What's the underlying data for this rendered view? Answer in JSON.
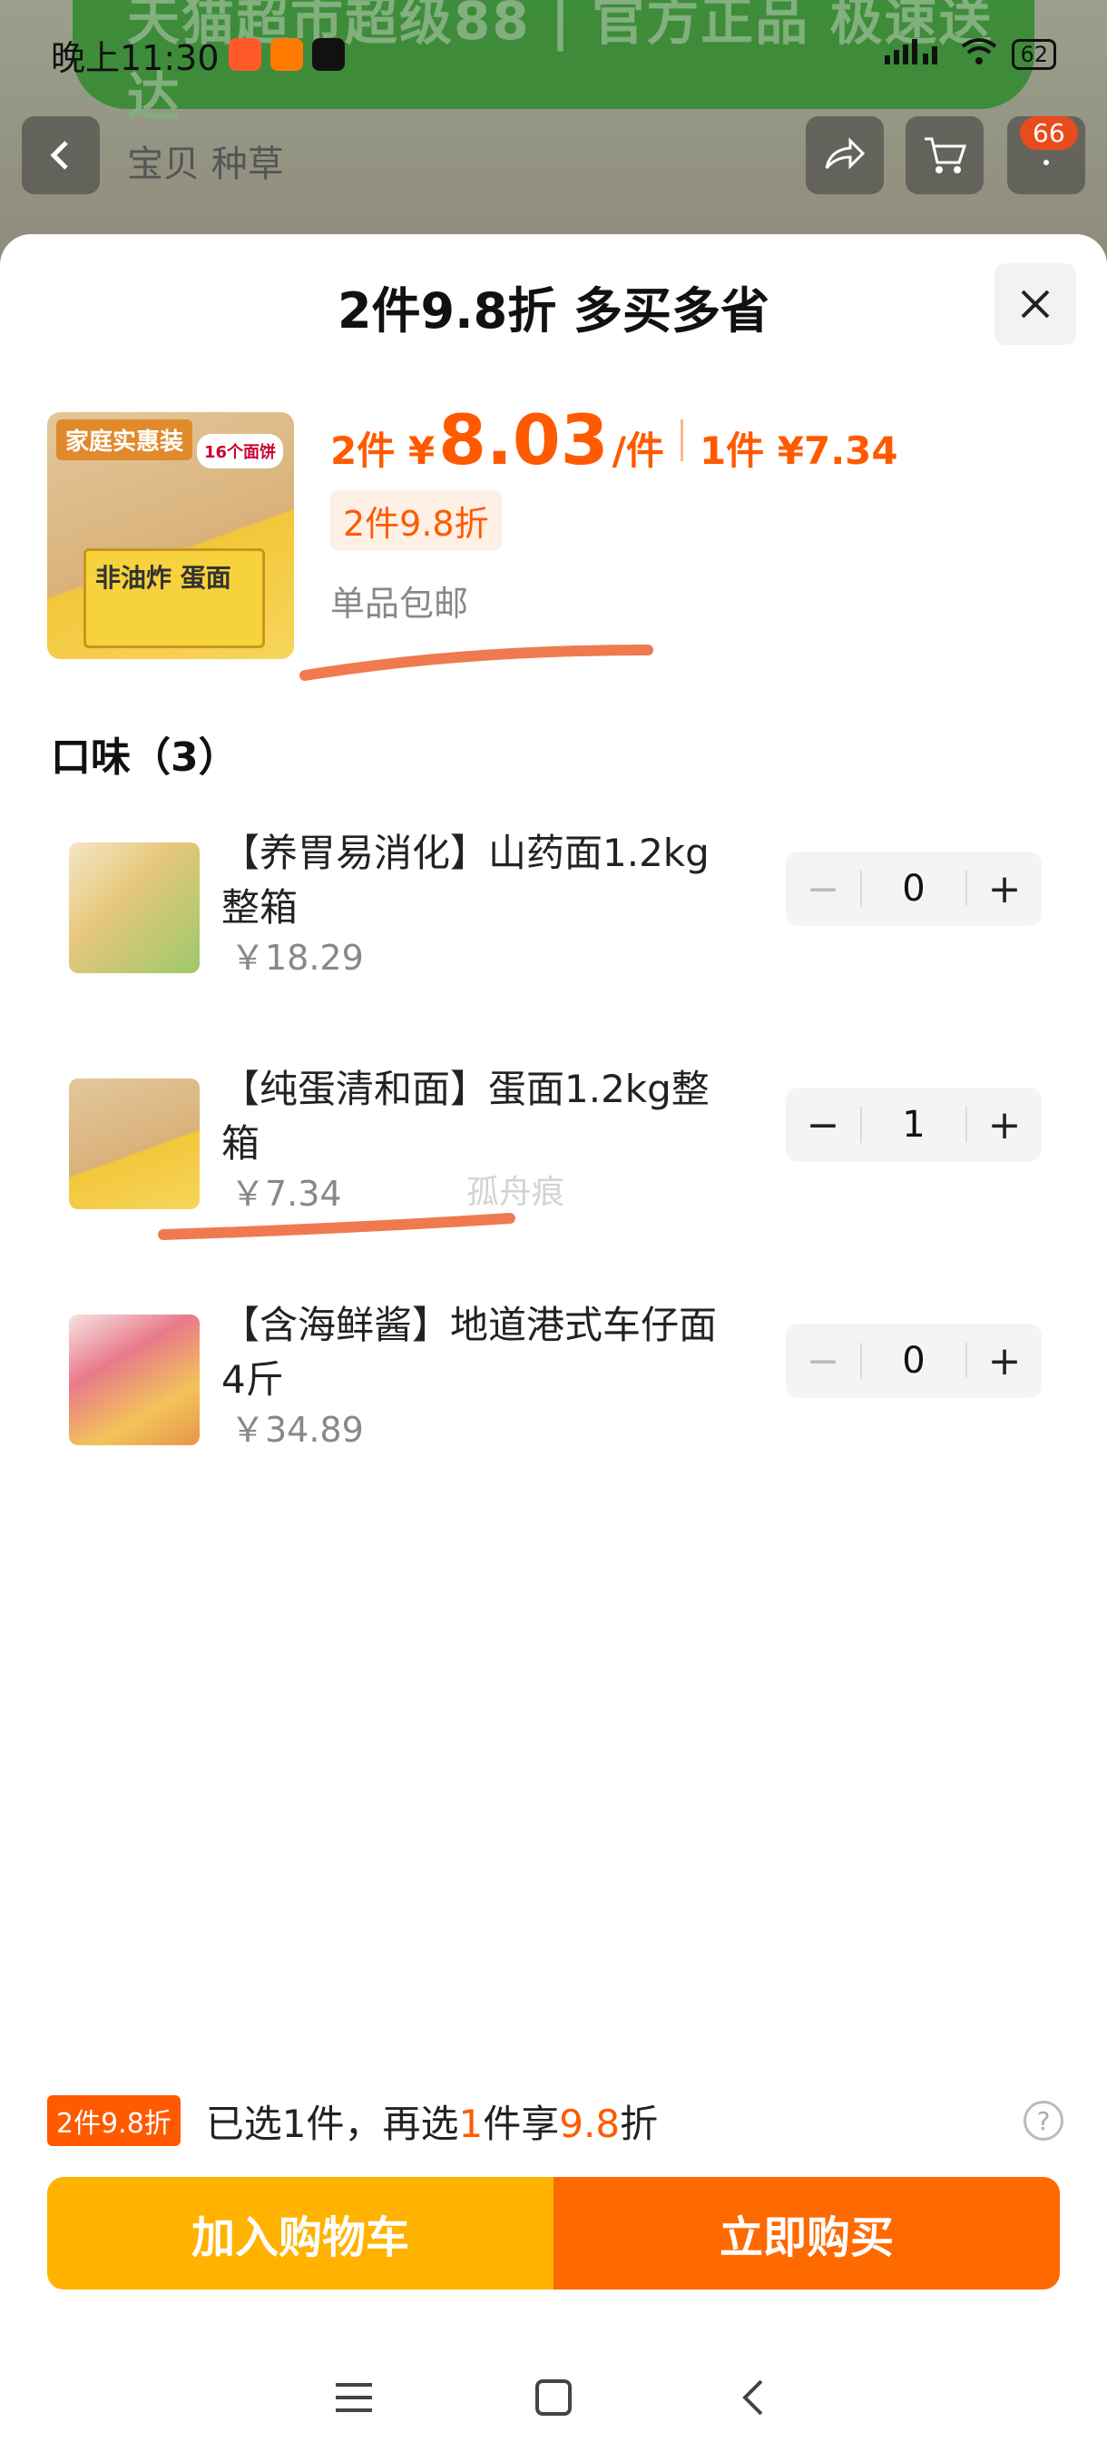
{
  "status": {
    "time": "晚上11:30",
    "battery": "62"
  },
  "background": {
    "banner_text": "天猫超市超级88 | 官方正品 极速送达",
    "tabs_text": "宝贝  种草",
    "cart_badge": "66"
  },
  "sheet": {
    "title": "2件9.8折 多买多省",
    "product": {
      "thumb_tag": "家庭实惠装",
      "thumb_tag2": "16个面饼",
      "thumb_box_text": "非油炸 蛋面",
      "price_prefix_2": "2件 ¥",
      "price_big": "8.03",
      "price_unit": "/件",
      "price_single": "1件 ¥7.34",
      "promo_chip": "2件9.8折",
      "ship_note": "单品包邮"
    },
    "section_title": "口味（3）",
    "items": [
      {
        "title": "【养胃易消化】山药面1.2kg整箱",
        "price": "￥18.29",
        "qty": "0"
      },
      {
        "title": "【纯蛋清和面】蛋面1.2kg整箱",
        "price": "￥7.34",
        "qty": "1"
      },
      {
        "title": "【含海鲜酱】地道港式车仔面4斤",
        "price": "￥34.89",
        "qty": "0"
      }
    ],
    "watermark": "孤舟痕",
    "promo_bar": {
      "tag": "2件9.8折",
      "text_a": "已选1件，再选",
      "text_hl1": "1",
      "text_b": "件享",
      "text_hl2": "9.8",
      "text_c": "折"
    },
    "buttons": {
      "add_cart": "加入购物车",
      "buy_now": "立即购买"
    }
  },
  "colors": {
    "accent": "#ff5a00",
    "cart_button": "#ffb300",
    "buy_button": "#ff6a00"
  }
}
